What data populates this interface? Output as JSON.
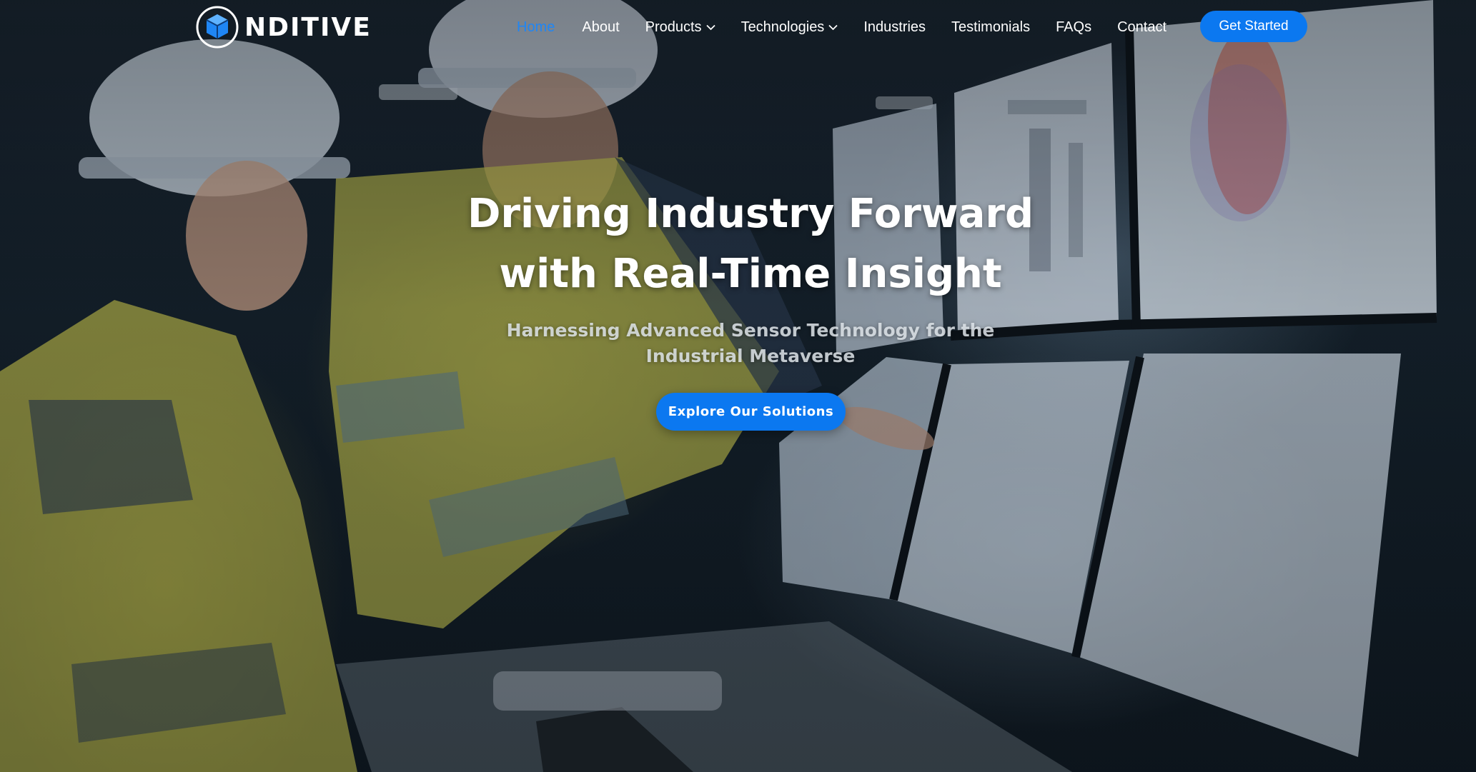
{
  "brand": {
    "logo_text": "NDITIVE",
    "logo_icon": "cube-circle-logo-icon"
  },
  "nav": {
    "items": [
      {
        "label": "Home",
        "active": true
      },
      {
        "label": "About"
      },
      {
        "label": "Products",
        "dropdown": true
      },
      {
        "label": "Technologies",
        "dropdown": true
      },
      {
        "label": "Industries"
      },
      {
        "label": "Testimonials"
      },
      {
        "label": "FAQs"
      },
      {
        "label": "Contact"
      }
    ],
    "cta_label": "Get Started"
  },
  "hero": {
    "title_line1": "Driving Industry Forward",
    "title_line2": "with Real-Time Insight",
    "subtitle": "Harnessing Advanced Sensor Technology for the Industrial Metaverse",
    "cta_label": "Explore Our Solutions",
    "background": "industrial-control-room-photo"
  },
  "colors": {
    "accent": "#0b78f0",
    "active_nav": "#1f86f5",
    "text": "#ffffff"
  }
}
